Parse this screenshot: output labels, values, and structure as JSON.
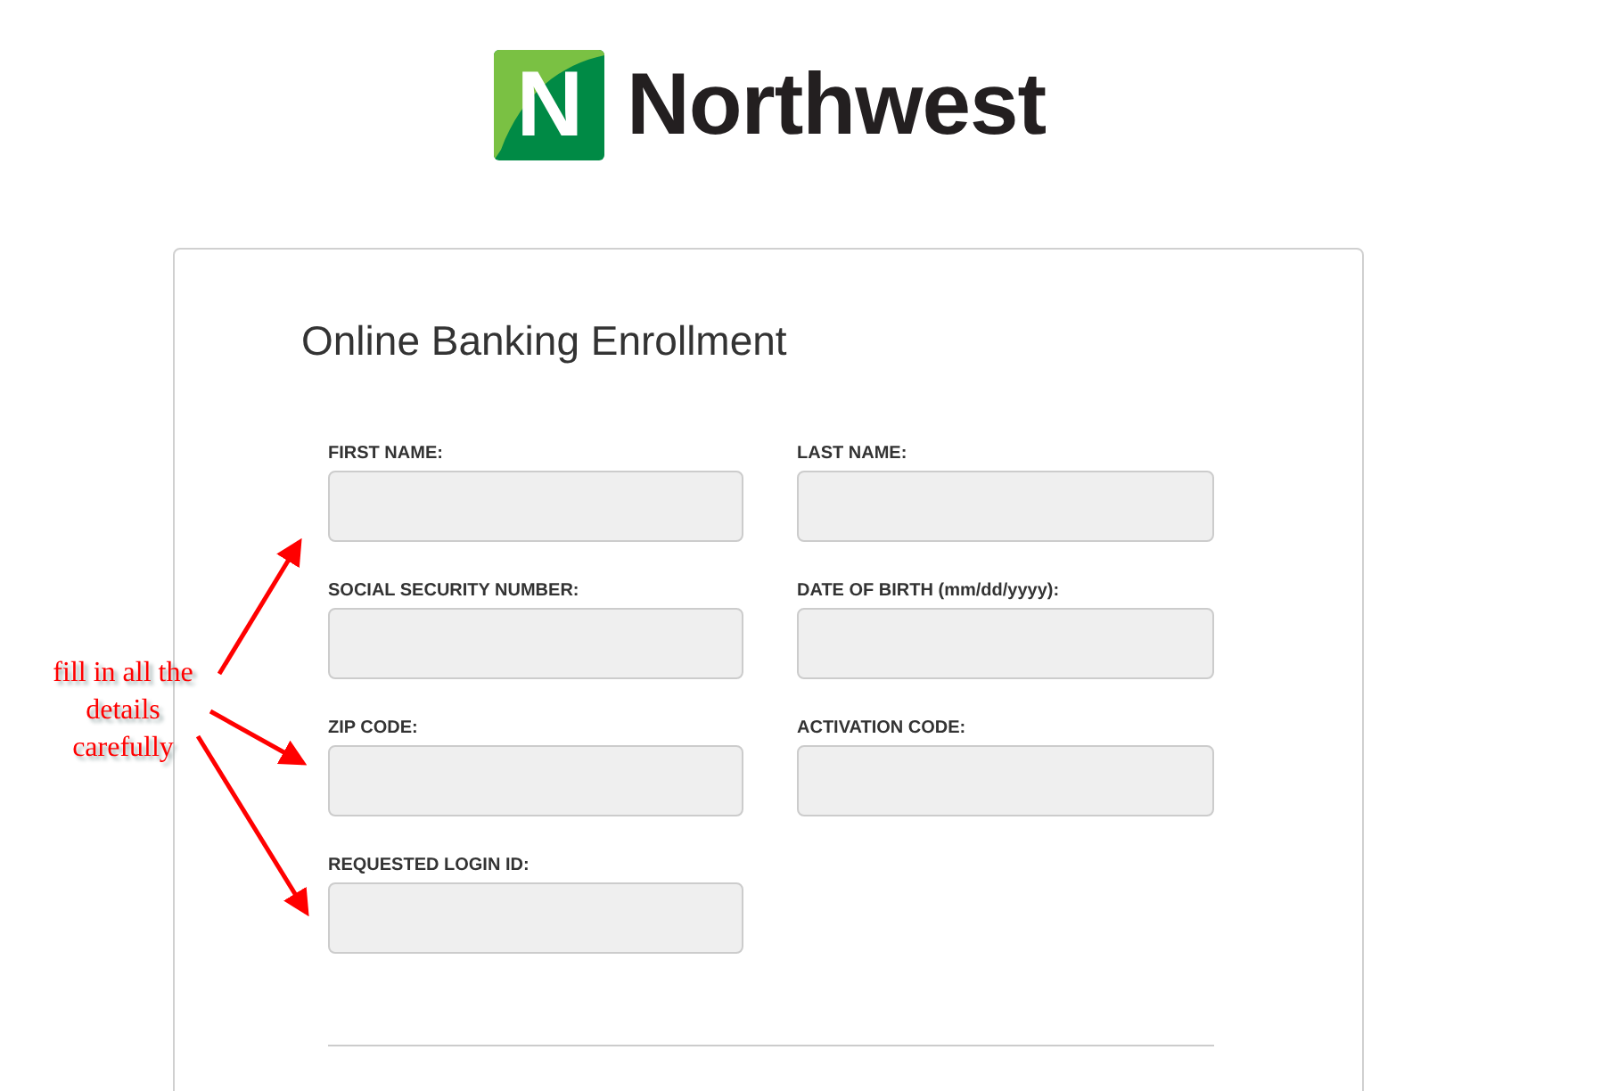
{
  "logo": {
    "mark": "N",
    "name": "Northwest"
  },
  "form": {
    "title": "Online Banking Enrollment",
    "fields": [
      {
        "label": "FIRST NAME:"
      },
      {
        "label": "LAST NAME:"
      },
      {
        "label": "SOCIAL SECURITY NUMBER:"
      },
      {
        "label": "DATE OF BIRTH (mm/dd/yyyy):"
      },
      {
        "label": "ZIP CODE:"
      },
      {
        "label": "ACTIVATION CODE:"
      },
      {
        "label": "REQUESTED LOGIN ID:"
      }
    ]
  },
  "annotation": {
    "text": "fill in all the details carefully"
  }
}
